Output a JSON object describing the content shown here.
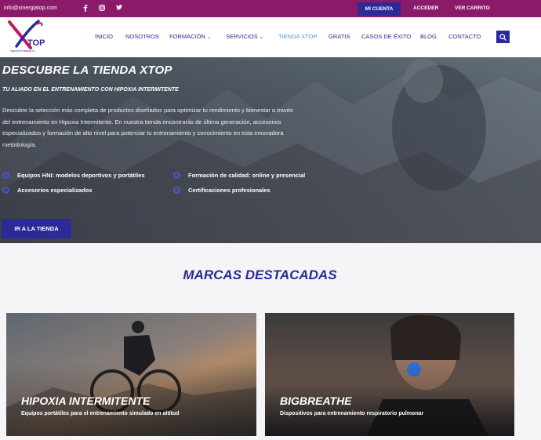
{
  "topbar": {
    "email": "info@xinergiatop.com",
    "social": [
      "f",
      "ig",
      "tw"
    ],
    "account": "MI CUENTA",
    "login": "ACCEDER",
    "cart": "VER CARRITO"
  },
  "logo": {
    "word": "TOP",
    "tagline": "Hypoxia Training S.L."
  },
  "nav": {
    "inicio": "INICIO",
    "nosotros": "NOSOTROS",
    "formacion": "FORMACIÓN",
    "servicios": "SERVICIOS",
    "tienda": "TIENDA XTOP",
    "gratis": "GRATIS",
    "casos": "CASOS DE ÉXITO",
    "blog": "BLOG",
    "contacto": "CONTACTO"
  },
  "hero": {
    "title": "DESCUBRE LA TIENDA XTOP",
    "subtitle": "TU ALIADO EN EL ENTRENAMIENTO CON HIPOXIA INTERMITENTE",
    "description": "Descubre la selección más completa de productos diseñados para optimizar tu rendimiento y bienestar a través del entrenamiento en Hipoxia Intermitente. En nuestra tienda encontrarás de última generación, accesorios especializados y formación de alto nivel para potenciar tu entrenamiento y conocimiento en esta innovadora metodología.",
    "features": [
      "Equipos HNI: modelos deportivos y portátiles",
      "Formación de calidad: online y presencial",
      "Accesorios especializados",
      "Certificaciones profesionales"
    ],
    "button": "IR A LA TIENDA"
  },
  "brands": {
    "title": "MARCAS DESTACADAS",
    "cards": [
      {
        "title": "HIPOXIA INTERMITENTE",
        "subtitle": "Equipos portátiles para el entrenamiento simulado en altitud"
      },
      {
        "title": "BIGBREATHE",
        "subtitle": "Dispositivos para entrenamiento respiratorio pulmonar"
      }
    ]
  },
  "colors": {
    "topbar": "#8c1a6a",
    "brand_blue": "#2a2b96",
    "active_link": "#4b9cd3"
  }
}
